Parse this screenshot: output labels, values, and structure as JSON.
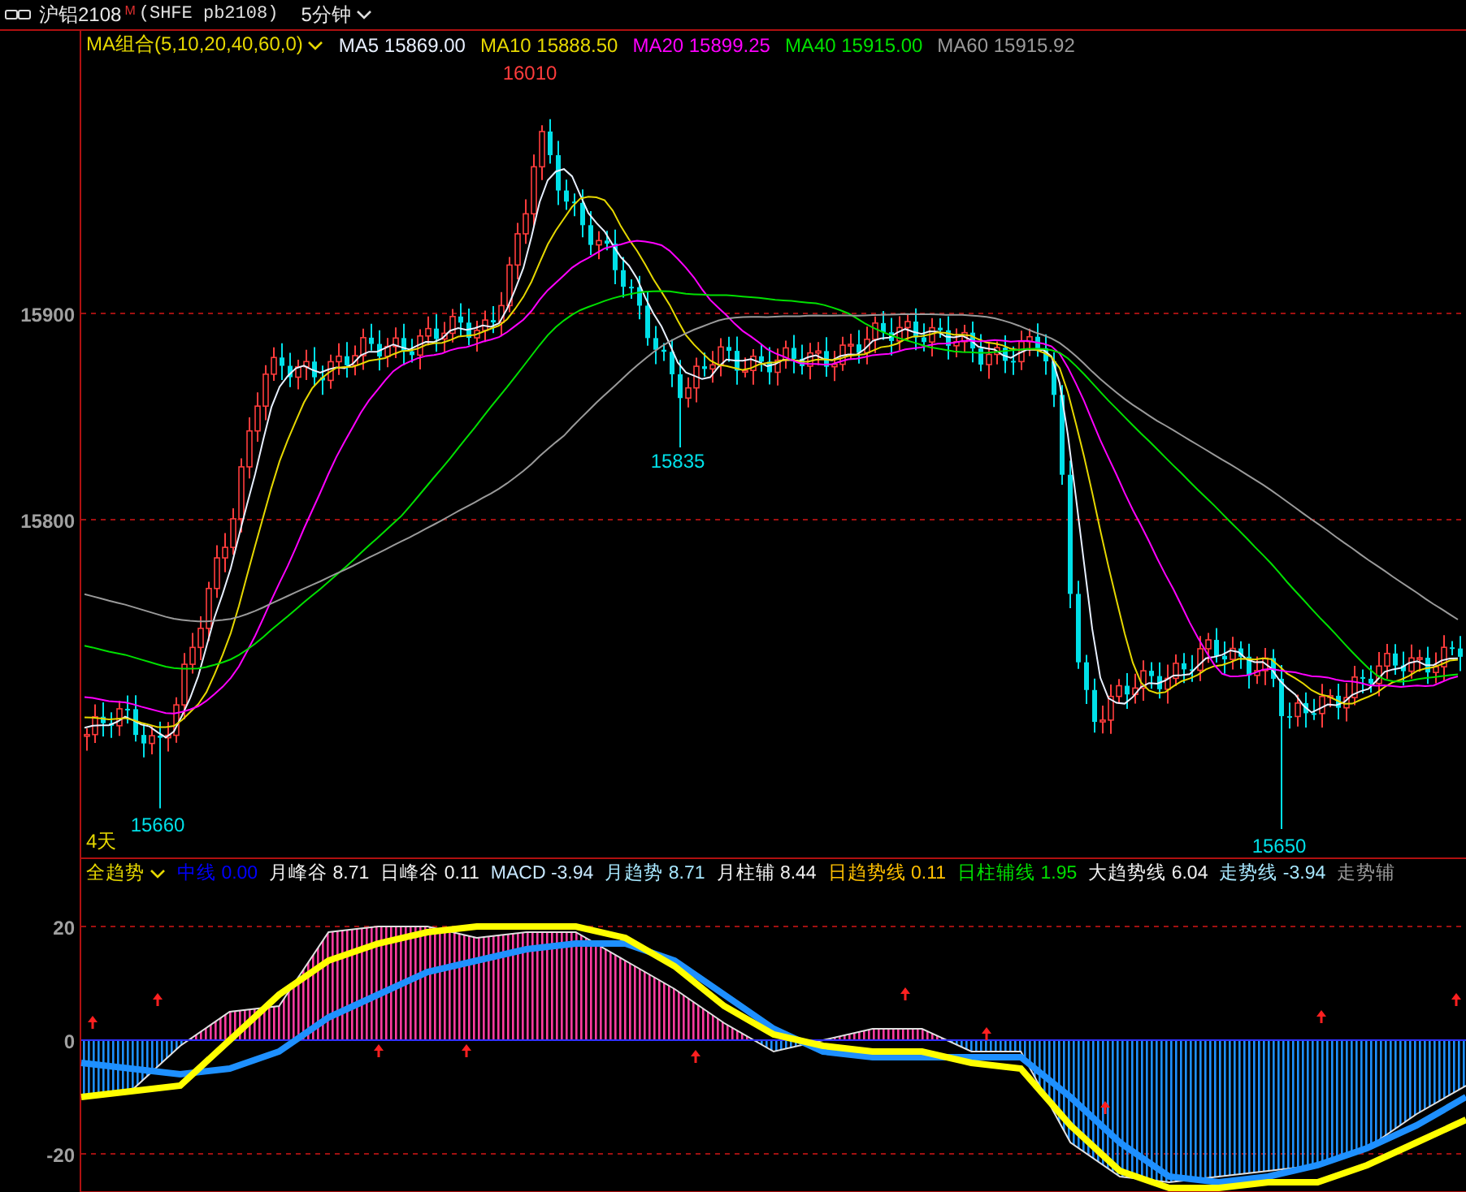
{
  "header": {
    "symbol": "沪铝2108",
    "badge": "M",
    "code": "(SHFE pb2108)",
    "period": "5分钟"
  },
  "ma_legend": {
    "title": "MA组合(5,10,20,40,60,0)",
    "items": [
      {
        "label": "MA5 15869.00",
        "color": "#e8f0ff"
      },
      {
        "label": "MA10 15888.50",
        "color": "#e6d800"
      },
      {
        "label": "MA20 15899.25",
        "color": "#ff00ff"
      },
      {
        "label": "MA40 15915.00",
        "color": "#00e000"
      },
      {
        "label": "MA60 15915.92",
        "color": "#9a9a9a"
      }
    ]
  },
  "price_axis": {
    "labels": [
      "15900",
      "15800"
    ]
  },
  "price_marks": [
    {
      "text": "16010",
      "color": "#ff3c3c"
    },
    {
      "text": "15835",
      "color": "#00e0e8"
    },
    {
      "text": "15660",
      "color": "#00e0e8"
    },
    {
      "text": "15650",
      "color": "#00e0e8"
    }
  ],
  "days_label": "4天",
  "indicator_legend": {
    "title": "全趋势",
    "items": [
      {
        "label": "中线 0.00",
        "color": "#0000ff"
      },
      {
        "label": "月峰谷 8.71",
        "color": "#f0f0f0"
      },
      {
        "label": "日峰谷 0.11",
        "color": "#f0f0f0"
      },
      {
        "label": "MACD -3.94",
        "color": "#c8e8ff"
      },
      {
        "label": "月趋势 8.71",
        "color": "#a8e8ff"
      },
      {
        "label": "月柱辅 8.44",
        "color": "#f0f0f0"
      },
      {
        "label": "日趋势线 0.11",
        "color": "#ffc000"
      },
      {
        "label": "日柱辅线 1.95",
        "color": "#00e000"
      },
      {
        "label": "大趋势线 6.04",
        "color": "#f0f0f0"
      },
      {
        "label": "走势线 -3.94",
        "color": "#a8e8ff"
      },
      {
        "label": "走势辅",
        "color": "#9a9a9a"
      }
    ]
  },
  "indicator_chart": {
    "chart_data": {
      "type": "area",
      "ylim": [
        -27,
        27
      ],
      "grid": true,
      "yticks": [
        {
          "value": 20,
          "label": "20"
        },
        {
          "value": 0,
          "label": "0"
        },
        {
          "value": -20,
          "label": "-20"
        }
      ],
      "series": [
        {
          "color": "#e0e0e0",
          "values": [
            -10,
            -9,
            -1,
            5,
            6,
            19,
            20,
            20,
            18,
            19,
            19,
            14,
            9,
            3,
            -2,
            0,
            2,
            2,
            -2,
            -2,
            -18,
            -24,
            -25,
            -24,
            -23,
            -22,
            -19,
            -13,
            -8
          ]
        },
        {
          "type": "line",
          "color": "#3030ff",
          "values": [
            0,
            0,
            0,
            0,
            0,
            0,
            0,
            0,
            0,
            0,
            0,
            0,
            0,
            0,
            0,
            0,
            0,
            0,
            0,
            0,
            0,
            0,
            0,
            0,
            0,
            0,
            0,
            0,
            0
          ]
        },
        {
          "type": "line",
          "color": "#1e90ff",
          "values": [
            -4,
            -5,
            -6,
            -5,
            -2,
            4,
            8,
            12,
            14,
            16,
            17,
            17,
            14,
            8,
            2,
            -2,
            -3,
            -3,
            -3,
            -3,
            -10,
            -18,
            -24,
            -25,
            -24,
            -22,
            -19,
            -15,
            -10
          ]
        },
        {
          "type": "line",
          "color": "#ffff00",
          "values": [
            -10,
            -9,
            -8,
            0,
            8,
            14,
            17,
            19,
            20,
            20,
            20,
            18,
            13,
            6,
            1,
            -1,
            -2,
            -2,
            -4,
            -5,
            -15,
            -23,
            -26,
            -26,
            -25,
            -25,
            -22,
            -18,
            -14
          ]
        }
      ]
    }
  }
}
